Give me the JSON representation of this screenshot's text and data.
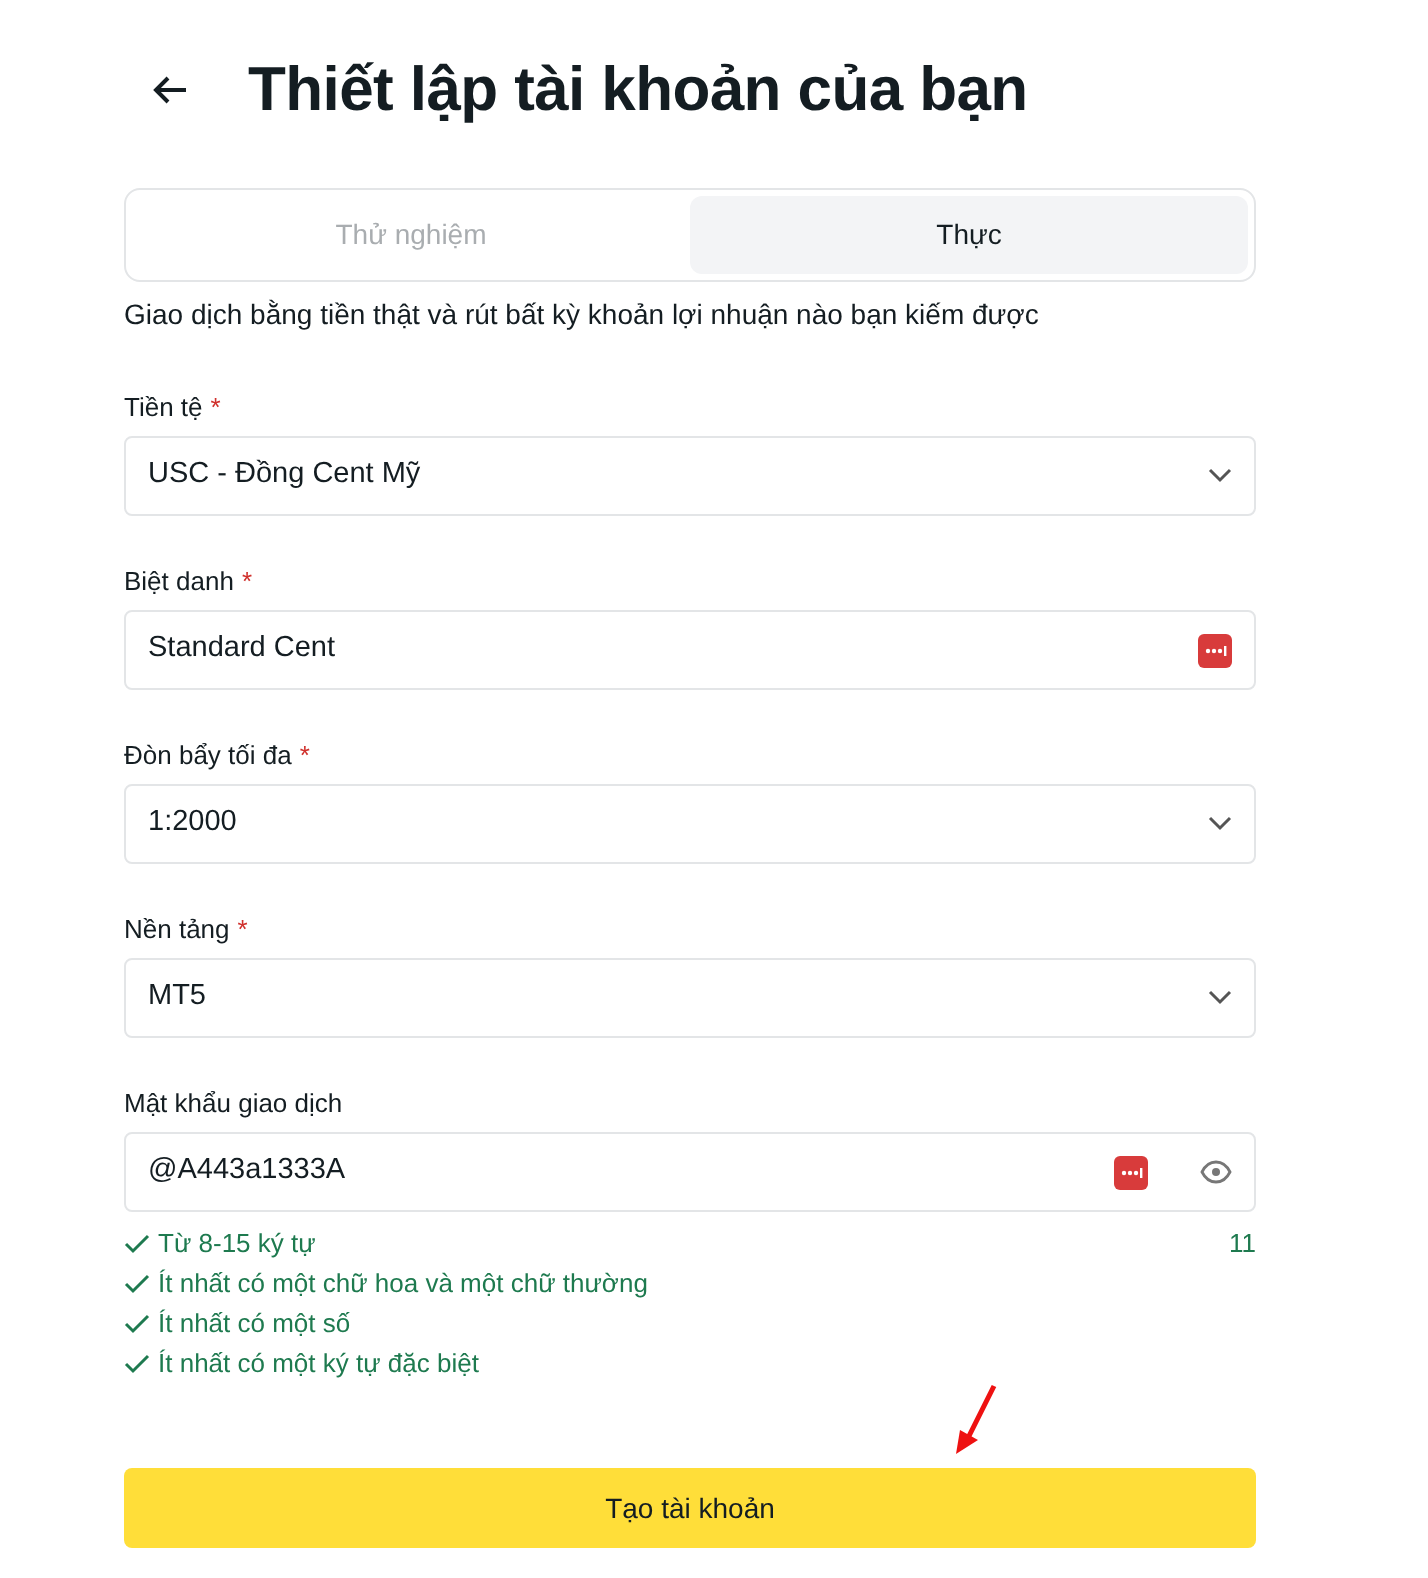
{
  "title": "Thiết lập tài khoản của bạn",
  "tabs": [
    {
      "label": "Thử nghiệm",
      "selected": false
    },
    {
      "label": "Thực",
      "selected": true
    }
  ],
  "description": "Giao dịch bằng tiền thật và rút bất kỳ khoản lợi nhuận nào bạn kiếm được",
  "fields": [
    {
      "kind": "select",
      "label": "Tiền tệ",
      "required_mark": "*",
      "value": "USC - Đồng Cent Mỹ"
    },
    {
      "kind": "text",
      "label": "Biệt danh",
      "required_mark": "*",
      "value": "Standard Cent"
    },
    {
      "kind": "select",
      "label": "Đòn bẩy tối đa",
      "required_mark": "*",
      "value": "1:2000"
    },
    {
      "kind": "select",
      "label": "Nền tảng",
      "required_mark": "*",
      "value": "MT5"
    },
    {
      "kind": "password",
      "label": "Mật khẩu giao dịch",
      "value": "@A443a1333A"
    }
  ],
  "password_rules": [
    {
      "text": "Từ 8-15 ký tự",
      "met": true
    },
    {
      "text": "Ít nhất có một chữ hoa và một chữ thường",
      "met": true
    },
    {
      "text": "Ít nhất có một số",
      "met": true
    },
    {
      "text": "Ít nhất có một ký tự đặc biệt",
      "met": true
    }
  ],
  "password_length": "11",
  "submit_button": "Tạo tài khoản"
}
